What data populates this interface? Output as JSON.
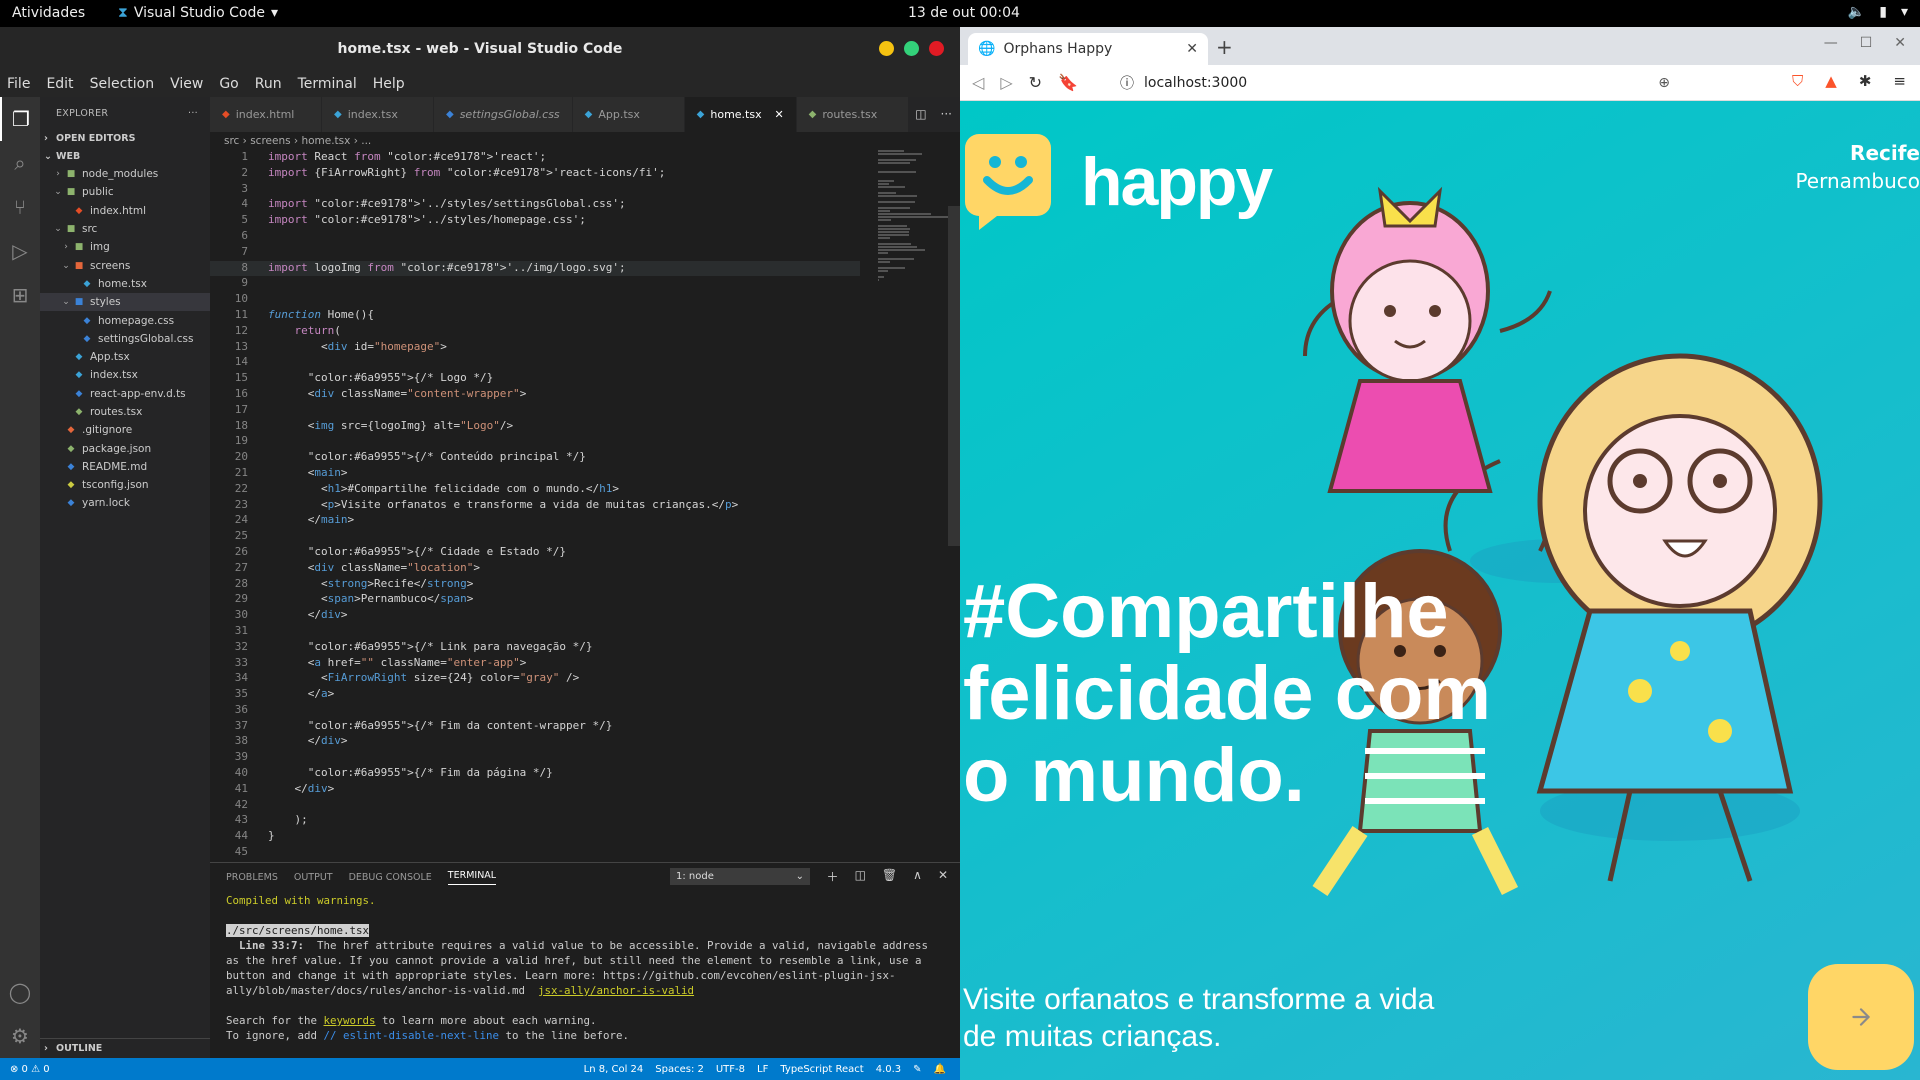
{
  "system": {
    "activities": "Atividades",
    "app_menu": "Visual Studio Code",
    "clock": "13 de out  00:04"
  },
  "vscode": {
    "title": "home.tsx - web - Visual Studio Code",
    "menu": [
      "File",
      "Edit",
      "Selection",
      "View",
      "Go",
      "Run",
      "Terminal",
      "Help"
    ],
    "explorer_label": "EXPLORER",
    "open_editors": "OPEN EDITORS",
    "workspace": "WEB",
    "outline": "OUTLINE",
    "tree": [
      {
        "label": "node_modules",
        "depth": 1,
        "kind": "folder",
        "chev": "›",
        "color": "#8db36d"
      },
      {
        "label": "public",
        "depth": 1,
        "kind": "folder-open",
        "chev": "⌄",
        "color": "#8db36d"
      },
      {
        "label": "index.html",
        "depth": 2,
        "kind": "file",
        "chev": "",
        "color": "#e44d26"
      },
      {
        "label": "src",
        "depth": 1,
        "kind": "folder-open",
        "chev": "⌄",
        "color": "#8db36d"
      },
      {
        "label": "img",
        "depth": 2,
        "kind": "folder",
        "chev": "›",
        "color": "#8db36d"
      },
      {
        "label": "screens",
        "depth": 2,
        "kind": "folder-open",
        "chev": "⌄",
        "color": "#e4663b"
      },
      {
        "label": "home.tsx",
        "depth": 3,
        "kind": "file",
        "chev": "",
        "color": "#3ba3d7"
      },
      {
        "label": "styles",
        "depth": 2,
        "kind": "folder-open",
        "chev": "⌄",
        "color": "#3b82d7",
        "selected": true
      },
      {
        "label": "homepage.css",
        "depth": 3,
        "kind": "file",
        "chev": "",
        "color": "#3b82d7"
      },
      {
        "label": "settingsGlobal.css",
        "depth": 3,
        "kind": "file",
        "chev": "",
        "color": "#3b82d7"
      },
      {
        "label": "App.tsx",
        "depth": 2,
        "kind": "file",
        "chev": "",
        "color": "#3ba3d7"
      },
      {
        "label": "index.tsx",
        "depth": 2,
        "kind": "file",
        "chev": "",
        "color": "#3ba3d7"
      },
      {
        "label": "react-app-env.d.ts",
        "depth": 2,
        "kind": "file",
        "chev": "",
        "color": "#3b82d7"
      },
      {
        "label": "routes.tsx",
        "depth": 2,
        "kind": "file",
        "chev": "",
        "color": "#8db36d"
      },
      {
        "label": ".gitignore",
        "depth": 1,
        "kind": "file",
        "chev": "",
        "color": "#e4663b"
      },
      {
        "label": "package.json",
        "depth": 1,
        "kind": "file",
        "chev": "",
        "color": "#8db36d"
      },
      {
        "label": "README.md",
        "depth": 1,
        "kind": "file",
        "chev": "",
        "color": "#3b82d7"
      },
      {
        "label": "tsconfig.json",
        "depth": 1,
        "kind": "file",
        "chev": "",
        "color": "#cbcb41"
      },
      {
        "label": "yarn.lock",
        "depth": 1,
        "kind": "file",
        "chev": "",
        "color": "#3b82d7"
      }
    ],
    "tabs": [
      {
        "label": "index.html",
        "color": "#e44d26",
        "italic": false
      },
      {
        "label": "index.tsx",
        "color": "#3ba3d7",
        "italic": false
      },
      {
        "label": "settingsGlobal.css",
        "color": "#3b82d7",
        "italic": true
      },
      {
        "label": "App.tsx",
        "color": "#3ba3d7",
        "italic": false
      },
      {
        "label": "home.tsx",
        "color": "#3ba3d7",
        "italic": false,
        "active": true
      },
      {
        "label": "routes.tsx",
        "color": "#8db36d",
        "italic": false
      }
    ],
    "breadcrumb": "src › screens › home.tsx › ...",
    "code_lines": [
      "import React from 'react';",
      "import {FiArrowRight} from 'react-icons/fi';",
      "",
      "import '../styles/settingsGlobal.css';",
      "import '../styles/homepage.css';",
      "",
      "",
      "import logoImg from '../img/logo.svg';",
      "",
      "",
      "function Home(){",
      "    return(",
      "        <div id=\"homepage\">",
      "",
      "      {/* Logo */}",
      "      <div className=\"content-wrapper\">",
      "",
      "      <img src={logoImg} alt=\"Logo\"/>",
      "",
      "      {/* Conteúdo principal */}",
      "      <main>",
      "        <h1>#Compartilhe felicidade com o mundo.</h1>",
      "        <p>Visite orfanatos e transforme a vida de muitas crianças.</p>",
      "      </main>",
      "",
      "      {/* Cidade e Estado */}",
      "      <div className=\"location\">",
      "        <strong>Recife</strong>",
      "        <span>Pernambuco</span>",
      "      </div>",
      "",
      "      {/* Link para navegação */}",
      "      <a href=\"\" className=\"enter-app\">",
      "        <FiArrowRight size={24} color=\"gray\" />",
      "      </a>",
      "",
      "      {/* Fim da content-wrapper */}",
      "      </div>",
      "",
      "      {/* Fim da página */}",
      "    </div>",
      "",
      "    );",
      "}",
      ""
    ],
    "highlight_line": 8,
    "panel_tabs": [
      "PROBLEMS",
      "OUTPUT",
      "DEBUG CONSOLE",
      "TERMINAL"
    ],
    "terminal_select": "1: node",
    "terminal": {
      "l1": "Compiled with warnings.",
      "l2": "./src/screens/home.tsx",
      "l3a": "  Line 33:7:",
      "l3b": "  The href attribute requires a valid value to be accessible. Provide a valid, navigable address as the href value. If you cannot provide a valid href, but still need the element to resemble a link, use a button and change it with appropriate styles. Learn more: https://github.com/evcohen/eslint-plugin-jsx-ally/blob/master/docs/rules/anchor-is-valid.md  ",
      "l3c": "jsx-ally/anchor-is-valid",
      "l4a": "Search for the ",
      "l4b": "keywords",
      "l4c": " to learn more about each warning.",
      "l5a": "To ignore, add ",
      "l5b": "// eslint-disable-next-line",
      "l5c": " to the line before."
    },
    "status": {
      "errors": "⊗ 0 ⚠ 0",
      "position": "Ln 8, Col 24",
      "spaces": "Spaces: 2",
      "encoding": "UTF-8",
      "eol": "LF",
      "language": "TypeScript React",
      "version": "4.0.3"
    }
  },
  "browser": {
    "tab_title": "Orphans Happy",
    "url": "localhost:3000",
    "page": {
      "logo_text": "happy",
      "city": "Recife",
      "state": "Pernambuco",
      "headline": "#Compartilhe felicidade com o mundo.",
      "subtitle": "Visite orfanatos e transforme a vida de muitas crianças."
    }
  },
  "colors": {
    "accent_vscode": "#007acc",
    "page_bg": "#15c3d6",
    "button_yellow": "#FFD666"
  }
}
